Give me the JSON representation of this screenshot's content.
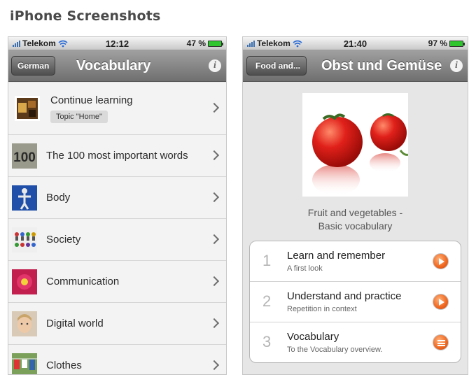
{
  "page": {
    "title": "iPhone Screenshots"
  },
  "colors": {
    "accent_orange": "#f0661e",
    "navbar_gray": "#7f7f7f",
    "battery_green": "#2ec52e"
  },
  "phone1": {
    "status": {
      "carrier": "Telekom",
      "time": "12:12",
      "battery": "47 %"
    },
    "nav": {
      "back_label": "German",
      "title": "Vocabulary",
      "info_icon": "i"
    },
    "items": [
      {
        "label": "Continue learning",
        "badge": "Topic \"Home\"",
        "icon": "home-photo-icon"
      },
      {
        "label": "The 100 most important words",
        "icon": "number-100-icon"
      },
      {
        "label": "Body",
        "icon": "body-statue-icon"
      },
      {
        "label": "Society",
        "icon": "people-figures-icon"
      },
      {
        "label": "Communication",
        "icon": "flower-icon"
      },
      {
        "label": "Digital world",
        "icon": "child-face-icon"
      },
      {
        "label": "Clothes",
        "icon": "clothes-line-icon"
      }
    ]
  },
  "phone2": {
    "status": {
      "carrier": "Telekom",
      "time": "21:40",
      "battery": "97 %"
    },
    "nav": {
      "back_label": "Food and...",
      "title": "Obst und Gemüse",
      "info_icon": "i"
    },
    "caption": {
      "line1": "Fruit and vegetables -",
      "line2": "Basic vocabulary"
    },
    "steps": [
      {
        "number": "1",
        "title": "Learn and remember",
        "subtitle": "A first look",
        "action": "play-icon"
      },
      {
        "number": "2",
        "title": "Understand and practice",
        "subtitle": "Repetition in context",
        "action": "play-icon"
      },
      {
        "number": "3",
        "title": "Vocabulary",
        "subtitle": "To the Vocabulary overview.",
        "action": "list-icon"
      }
    ]
  }
}
